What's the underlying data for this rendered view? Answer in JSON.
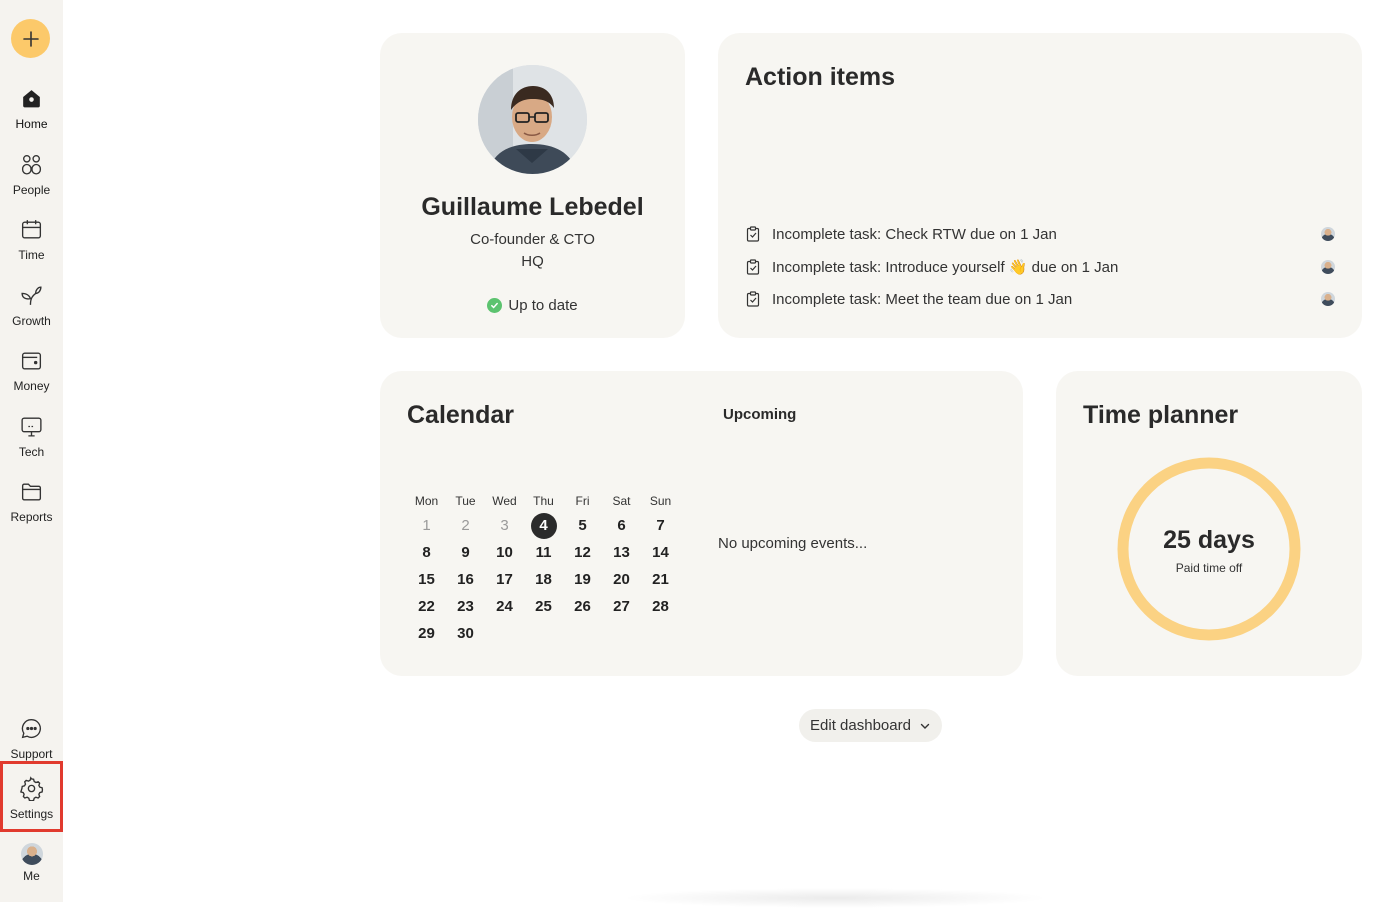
{
  "sidebar": {
    "add_icon": "plus-icon",
    "items": [
      {
        "label": "Home",
        "icon": "home-icon"
      },
      {
        "label": "People",
        "icon": "people-icon"
      },
      {
        "label": "Time",
        "icon": "calendar-icon"
      },
      {
        "label": "Growth",
        "icon": "sprout-icon"
      },
      {
        "label": "Money",
        "icon": "wallet-icon"
      },
      {
        "label": "Tech",
        "icon": "monitor-icon"
      },
      {
        "label": "Reports",
        "icon": "folder-icon"
      }
    ],
    "bottom_items": [
      {
        "label": "Support",
        "icon": "chat-icon"
      },
      {
        "label": "Settings",
        "icon": "gear-icon"
      },
      {
        "label": "Me",
        "icon": "avatar"
      }
    ]
  },
  "profile": {
    "name": "Guillaume Lebedel",
    "role": "Co-founder & CTO",
    "location": "HQ",
    "status": "Up to date"
  },
  "action_items": {
    "title": "Action items",
    "items": [
      {
        "text": "Incomplete task: Check RTW due on 1 Jan"
      },
      {
        "text": "Incomplete task: Introduce yourself 👋 due on 1 Jan"
      },
      {
        "text": "Incomplete task: Meet the team due on 1 Jan"
      }
    ]
  },
  "calendar": {
    "title": "Calendar",
    "upcoming_label": "Upcoming",
    "no_events": "No upcoming events...",
    "weekdays": [
      "Mon",
      "Tue",
      "Wed",
      "Thu",
      "Fri",
      "Sat",
      "Sun"
    ],
    "days": [
      "1",
      "2",
      "3",
      "4",
      "5",
      "6",
      "7",
      "8",
      "9",
      "10",
      "11",
      "12",
      "13",
      "14",
      "15",
      "16",
      "17",
      "18",
      "19",
      "20",
      "21",
      "22",
      "23",
      "24",
      "25",
      "26",
      "27",
      "28",
      "29",
      "30"
    ],
    "today": "4"
  },
  "time_planner": {
    "title": "Time planner",
    "value": "25 days",
    "label": "Paid time off",
    "ring_color": "#fbd283"
  },
  "footer": {
    "edit_label": "Edit dashboard"
  },
  "colors": {
    "accent": "#fcc96a",
    "highlight": "#e13a2e",
    "success": "#5cc36f"
  }
}
